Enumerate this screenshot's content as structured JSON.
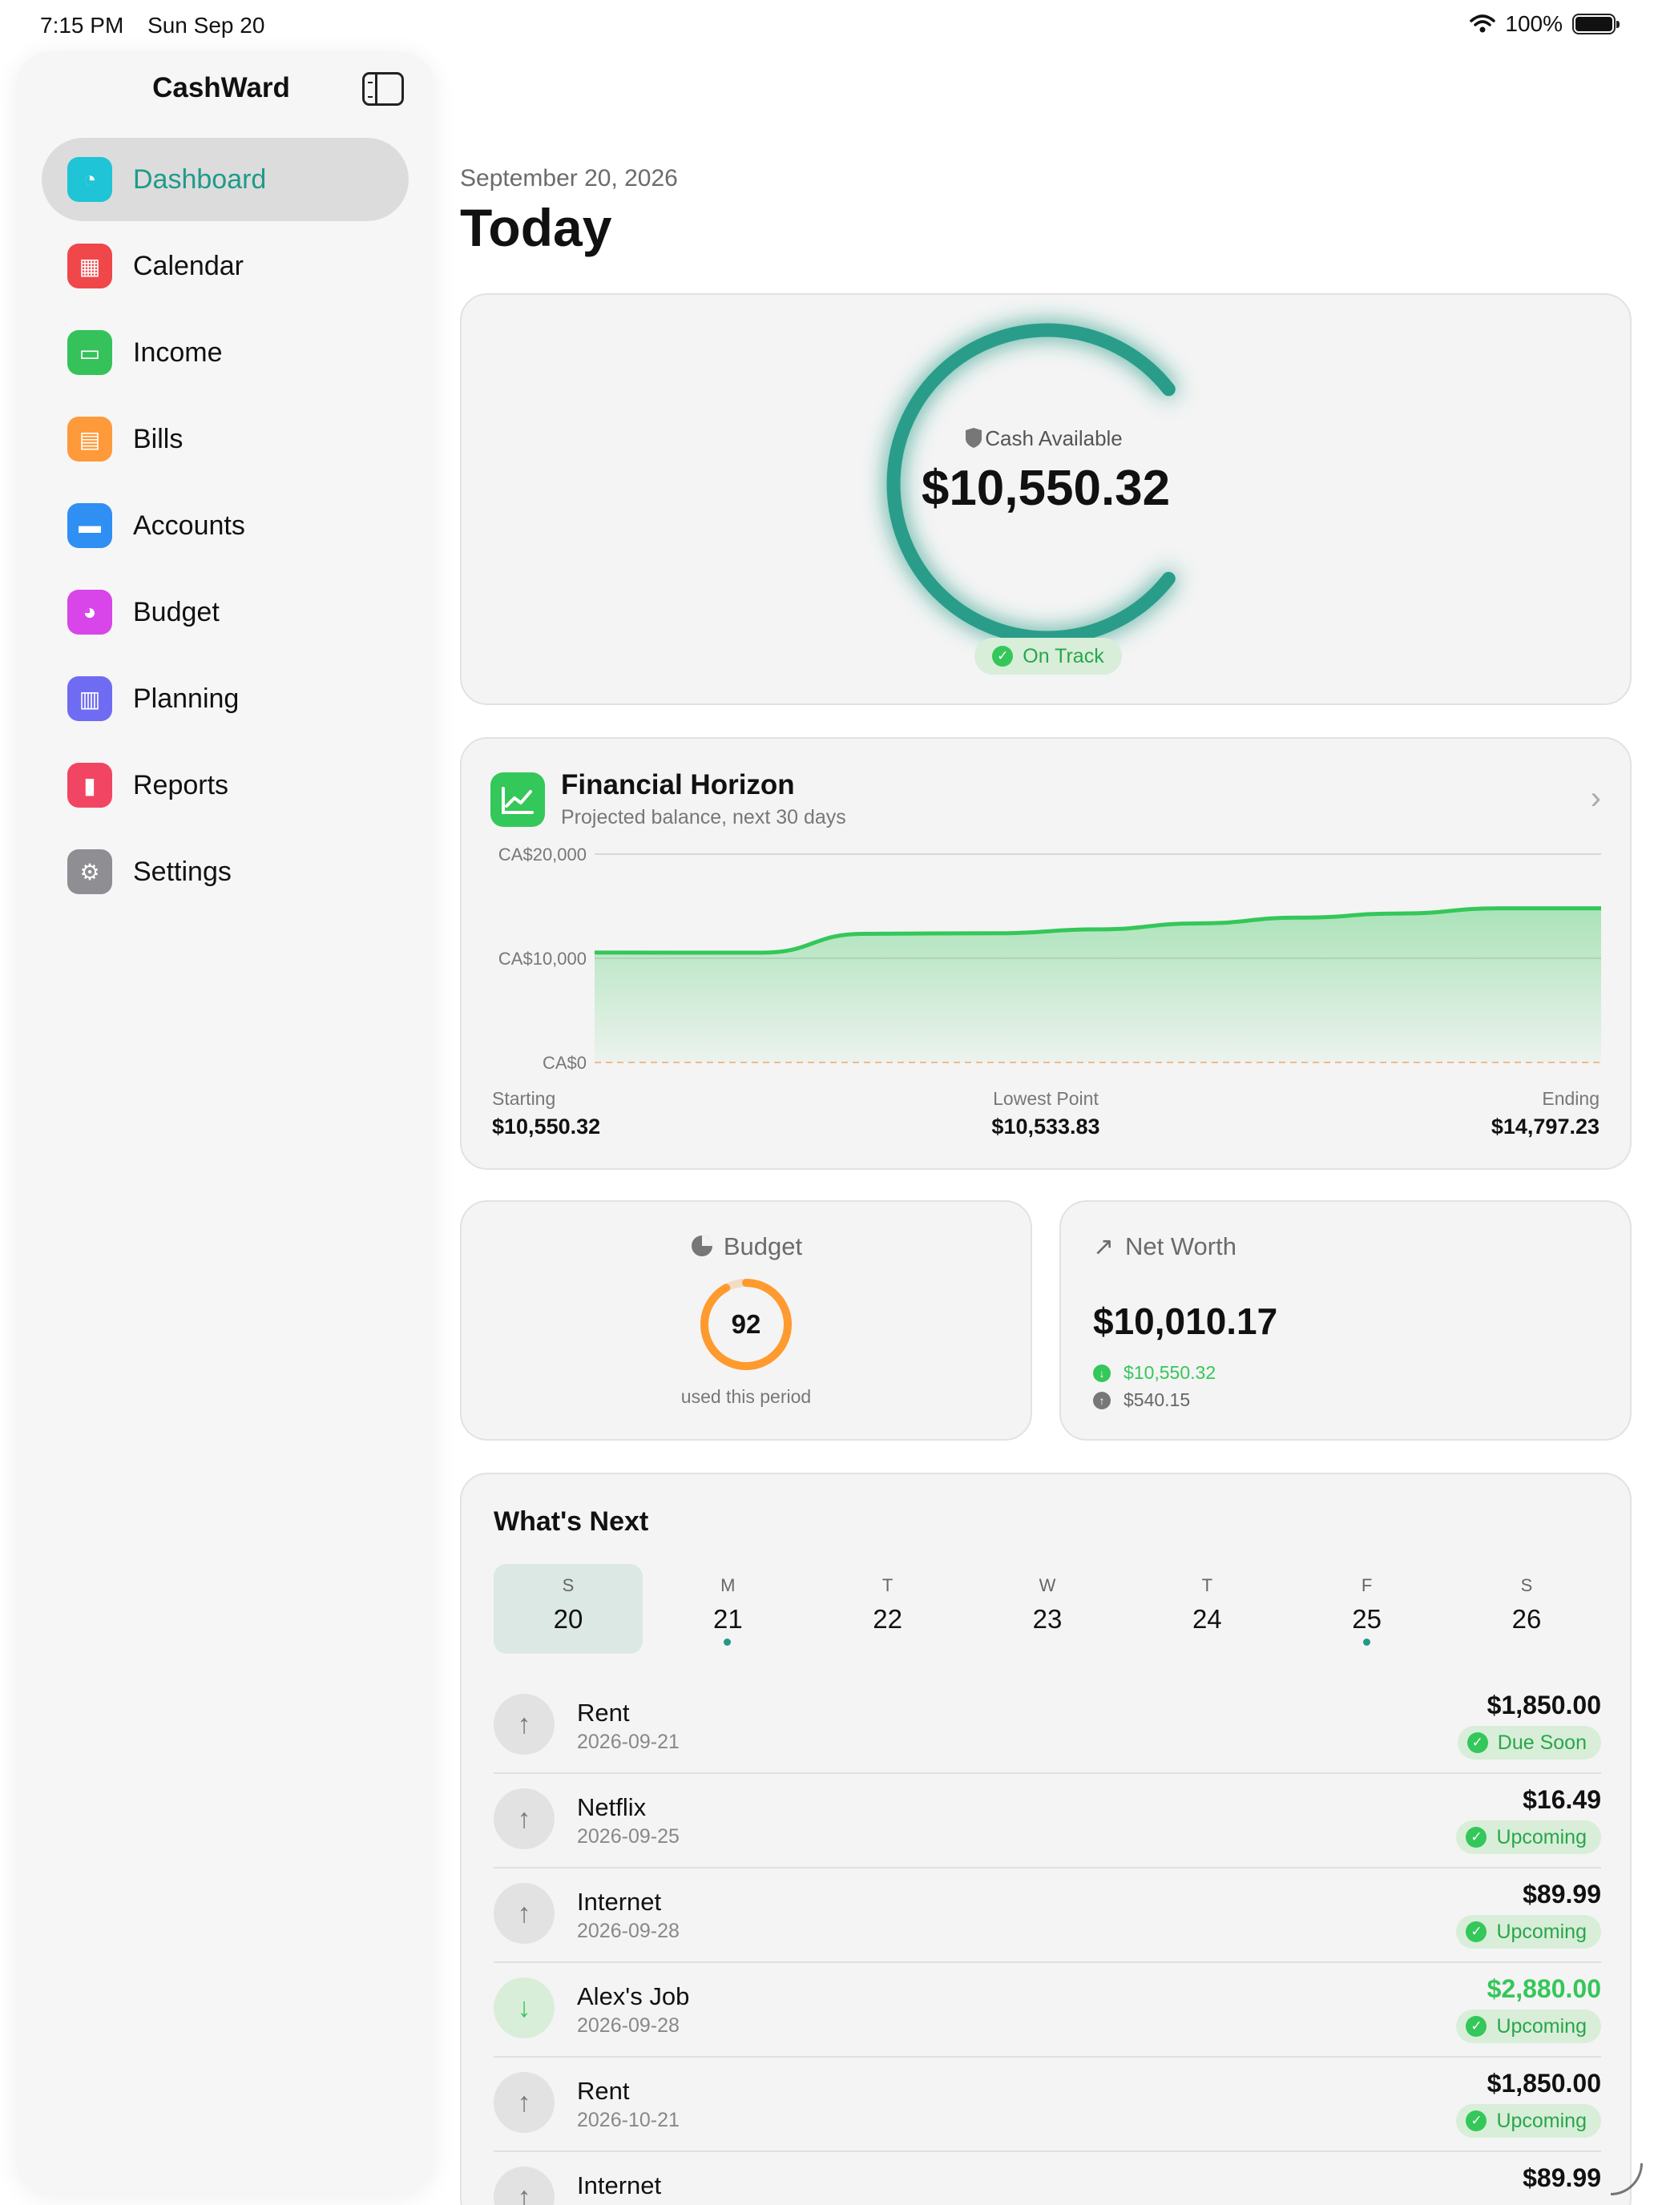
{
  "status_bar": {
    "time": "7:15 PM",
    "date": "Sun Sep 20",
    "battery": "100%"
  },
  "sidebar": {
    "title": "CashWard",
    "items": [
      {
        "label": "Dashboard",
        "icon": "gauge-icon",
        "color": "#1fc4d6",
        "active": true
      },
      {
        "label": "Calendar",
        "icon": "calendar-icon",
        "color": "#f0474a"
      },
      {
        "label": "Income",
        "icon": "banknote-icon",
        "color": "#35c25a"
      },
      {
        "label": "Bills",
        "icon": "document-icon",
        "color": "#ff9a3b"
      },
      {
        "label": "Accounts",
        "icon": "credit-card-icon",
        "color": "#2f8ff2"
      },
      {
        "label": "Budget",
        "icon": "pie-chart-icon",
        "color": "#d845e8"
      },
      {
        "label": "Planning",
        "icon": "map-icon",
        "color": "#6f6cf3"
      },
      {
        "label": "Reports",
        "icon": "bar-chart-icon",
        "color": "#f24563"
      },
      {
        "label": "Settings",
        "icon": "gear-icon",
        "color": "#8e8e93"
      }
    ]
  },
  "header": {
    "date": "September 20, 2026",
    "title": "Today"
  },
  "cash": {
    "label": "Cash Available",
    "value": "$10,550.32",
    "status": "On Track",
    "accent": "#2a9d8a"
  },
  "horizon": {
    "title": "Financial Horizon",
    "subtitle": "Projected balance, next 30 days",
    "starting_label": "Starting",
    "starting_value": "$10,550.32",
    "lowest_label": "Lowest Point",
    "lowest_value": "$10,533.83",
    "ending_label": "Ending",
    "ending_value": "$14,797.23"
  },
  "chart_data": {
    "type": "area",
    "title": "Financial Horizon",
    "y_ticks": [
      "CA$20,000",
      "CA$10,000",
      "CA$0"
    ],
    "ylim": [
      0,
      20000
    ],
    "grid": true,
    "x": [
      0,
      5,
      8,
      10,
      12,
      15,
      18,
      21,
      24,
      27,
      30
    ],
    "values": [
      10550,
      10534,
      12350,
      12380,
      12400,
      12780,
      13350,
      13900,
      14300,
      14797,
      14797
    ],
    "color": "#34c759"
  },
  "budget": {
    "label": "Budget",
    "value": "92",
    "percent": 92,
    "caption": "used this period",
    "color": "#ff9a2e"
  },
  "net_worth": {
    "label": "Net Worth",
    "value": "$10,010.17",
    "assets": "$10,550.32",
    "liabilities": "$540.15"
  },
  "whats_next": {
    "title": "What's Next",
    "days": [
      {
        "letter": "S",
        "num": "20",
        "selected": true,
        "dot": false
      },
      {
        "letter": "M",
        "num": "21",
        "dot": true
      },
      {
        "letter": "T",
        "num": "22",
        "dot": false
      },
      {
        "letter": "W",
        "num": "23",
        "dot": false
      },
      {
        "letter": "T",
        "num": "24",
        "dot": false
      },
      {
        "letter": "F",
        "num": "25",
        "dot": true
      },
      {
        "letter": "S",
        "num": "26",
        "dot": false
      }
    ],
    "items": [
      {
        "name": "Rent",
        "date": "2026-09-21",
        "amount": "$1,850.00",
        "status": "Due Soon",
        "income": false
      },
      {
        "name": "Netflix",
        "date": "2026-09-25",
        "amount": "$16.49",
        "status": "Upcoming",
        "income": false
      },
      {
        "name": "Internet",
        "date": "2026-09-28",
        "amount": "$89.99",
        "status": "Upcoming",
        "income": false
      },
      {
        "name": "Alex's Job",
        "date": "2026-09-28",
        "amount": "$2,880.00",
        "status": "Upcoming",
        "income": true
      },
      {
        "name": "Rent",
        "date": "2026-10-21",
        "amount": "$1,850.00",
        "status": "Upcoming",
        "income": false
      },
      {
        "name": "Internet",
        "date": "",
        "amount": "$89.99",
        "status": "",
        "income": false
      }
    ]
  }
}
